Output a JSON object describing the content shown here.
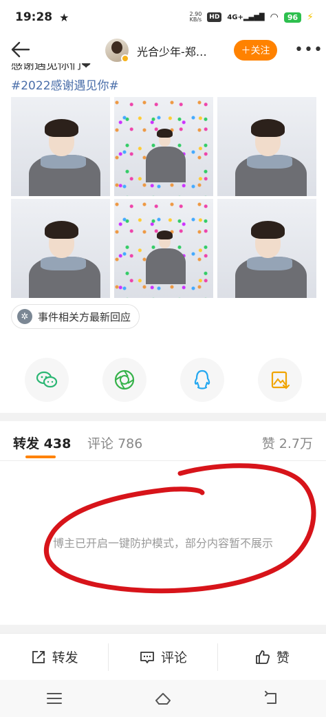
{
  "status": {
    "time": "19:28",
    "net_speed": "2.90",
    "net_unit": "KB/s",
    "hd": "HD",
    "signal": "4G+",
    "battery": "96"
  },
  "header": {
    "username": "光合少年-郑…",
    "follow_label": "＋关注"
  },
  "post": {
    "cut_text": "感谢遇见你们❤",
    "hashtag": "#2022感谢遇见你#",
    "event_tag": "事件相关方最新回应"
  },
  "tabs": {
    "repost_label": "转发",
    "repost_count": "438",
    "comment_label": "评论",
    "comment_count": "786",
    "like_label": "赞",
    "like_count": "2.7万"
  },
  "protect_notice": "博主已开启一键防护模式，部分内容暂不展示",
  "actions": {
    "repost": "转发",
    "comment": "评论",
    "like": "赞"
  },
  "colors": {
    "accent": "#ff8200",
    "link": "#4a6ea9",
    "annotation": "#d7141a"
  }
}
